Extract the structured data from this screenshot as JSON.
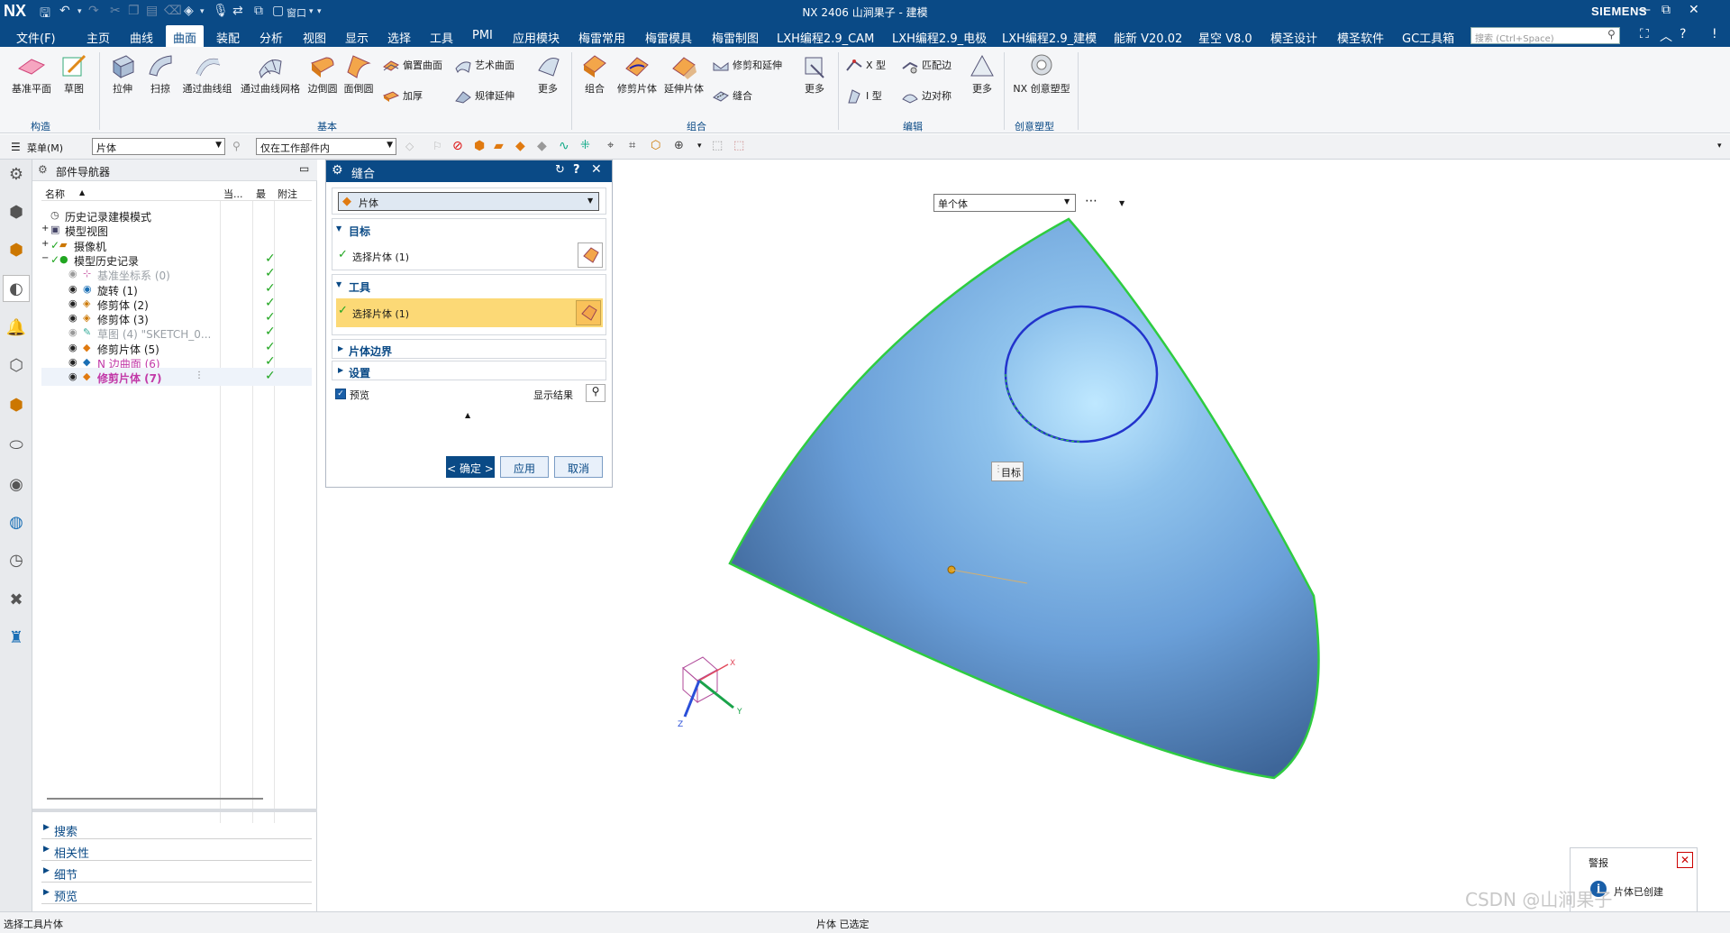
{
  "app": {
    "logo": "NX",
    "title": "NX 2406 山涧果子 - 建模",
    "brand": "SIEMENS",
    "window_label": "窗口"
  },
  "menu": {
    "file": "文件(F)",
    "tabs": [
      "主页",
      "曲线",
      "曲面",
      "装配",
      "分析",
      "视图",
      "显示",
      "选择",
      "工具",
      "PMI",
      "应用模块",
      "梅雷常用",
      "梅雷模具",
      "梅雷制图",
      "LXH编程2.9_CAM",
      "LXH编程2.9_电极",
      "LXH编程2.9_建模",
      "能新 V20.02",
      "星空 V8.0",
      "模圣设计",
      "模圣软件",
      "GC工具箱"
    ],
    "active_tab": "曲面",
    "search_placeholder": "搜索 (Ctrl+Space)"
  },
  "ribbon": {
    "construct": {
      "label": "构造",
      "buttons": [
        "基准平面",
        "草图"
      ]
    },
    "basic": {
      "label": "基本",
      "buttons": [
        "拉伸",
        "扫掠",
        "通过曲线组",
        "通过曲线网格",
        "边倒圆",
        "面倒圆"
      ],
      "small": [
        "偏置曲面",
        "艺术曲面",
        "加厚",
        "规律延伸"
      ],
      "more": "更多"
    },
    "combine": {
      "label": "组合",
      "buttons": [
        "组合",
        "修剪片体",
        "延伸片体"
      ],
      "small": [
        "修剪和延伸",
        "缝合"
      ],
      "more": "更多"
    },
    "edit": {
      "label": "编辑",
      "small": [
        "X 型",
        "匹配边",
        "I 型",
        "边对称"
      ],
      "more": "更多"
    },
    "creative": {
      "label": "创意塑型",
      "buttons": [
        "NX 创意塑型"
      ]
    }
  },
  "toolbar2": {
    "menu_label": "菜单(M)",
    "filter_value": "片体",
    "scope_value": "仅在工作部件内"
  },
  "part_navigator": {
    "title": "部件导航器",
    "columns": [
      "名称",
      "当...",
      "最",
      "附注"
    ],
    "rows": [
      {
        "label": "历史记录建模模式",
        "style": "normal",
        "check": false
      },
      {
        "label": "模型视图",
        "style": "normal",
        "check": false
      },
      {
        "label": "摄像机",
        "style": "normal",
        "check": false
      },
      {
        "label": "模型历史记录",
        "style": "normal",
        "check": true
      },
      {
        "label": "基准坐标系 (0)",
        "style": "grey",
        "check": true
      },
      {
        "label": "旋转 (1)",
        "style": "normal",
        "check": true
      },
      {
        "label": "修剪体 (2)",
        "style": "normal",
        "check": true
      },
      {
        "label": "修剪体 (3)",
        "style": "normal",
        "check": true
      },
      {
        "label": "草图 (4) \"SKETCH_0...",
        "style": "grey",
        "check": true
      },
      {
        "label": "修剪片体 (5)",
        "style": "normal",
        "check": true
      },
      {
        "label": "N 边曲面 (6)",
        "style": "magenta",
        "check": true
      },
      {
        "label": "修剪片体 (7)",
        "style": "magenta-bold",
        "check": true
      }
    ],
    "panels": [
      "搜索",
      "相关性",
      "细节",
      "预览"
    ]
  },
  "dialog": {
    "title": "缝合",
    "type_value": "片体",
    "target": {
      "header": "目标",
      "select_label": "选择片体 (1)"
    },
    "tool": {
      "header": "工具",
      "select_label": "选择片体 (1)"
    },
    "collapsed": [
      "片体边界",
      "设置"
    ],
    "preview_label": "预览",
    "show_result": "显示结果",
    "ok": "< 确定 >",
    "apply": "应用",
    "cancel": "取消"
  },
  "viewport": {
    "body_mode": "单个体",
    "target_tag": "目标",
    "axes": {
      "x": "X",
      "y": "Y",
      "z": "Z"
    },
    "colors": {
      "surface": "#6a9fd8",
      "edge": "#2ecc40",
      "circle": "#2233cc"
    }
  },
  "alert": {
    "title": "警报",
    "message": "片体已创建"
  },
  "status": {
    "left": "选择工具片体",
    "center": "片体 已选定"
  },
  "watermark": "CSDN @山涧果子"
}
